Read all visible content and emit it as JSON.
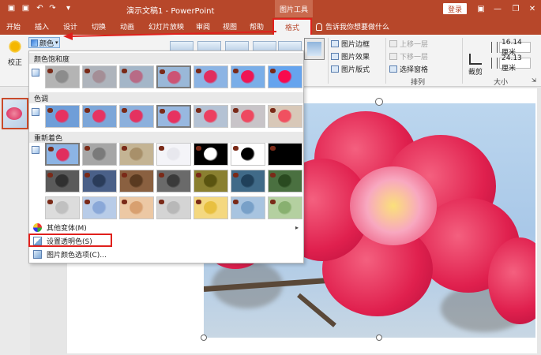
{
  "titlebar": {
    "title": "演示文稿1  -  PowerPoint",
    "picture_tools": "图片工具",
    "login": "登录",
    "minimize": "—",
    "restore": "❐",
    "close": "✕"
  },
  "tabs": {
    "start": "开始",
    "insert": "插入",
    "design": "设计",
    "transitions": "切换",
    "animations": "动画",
    "slideshow": "幻灯片放映",
    "review": "审阅",
    "view": "视图",
    "help": "帮助",
    "format": "格式",
    "tell_me": "告诉我你想要做什么"
  },
  "ribbon": {
    "correct": "校正",
    "color": "颜色",
    "picture_border": "图片边框",
    "picture_effects": "图片效果",
    "picture_layout": "图片版式",
    "bring_forward": "上移一层",
    "send_backward": "下移一层",
    "selection_pane": "选择窗格",
    "arrange": "排列",
    "crop": "裁剪",
    "height": "16.14 厘米",
    "width": "24.13 厘米",
    "size": "大小"
  },
  "dropdown": {
    "saturation_header": "颜色饱和度",
    "tone_header": "色调",
    "recolor_header": "重新着色",
    "more_variations": "其他变体(M)",
    "set_transparent": "设置透明色(S)",
    "color_options": "图片颜色选项(C)...",
    "saturation": [
      {
        "flower": "#8c8c8c",
        "bg": "#b4b4b4"
      },
      {
        "flower": "#a48e96",
        "bg": "#aeb4bc"
      },
      {
        "flower": "#b86b86",
        "bg": "#a4b6c8"
      },
      {
        "flower": "#cc5474",
        "bg": "#9ab8d8"
      },
      {
        "flower": "#e02e5e",
        "bg": "#8cb4e4"
      },
      {
        "flower": "#ee1654",
        "bg": "#7aaee8"
      },
      {
        "flower": "#f80a4e",
        "bg": "#66a4ee"
      }
    ],
    "tone": [
      {
        "flower": "#e63260",
        "bg": "#6f9ed8"
      },
      {
        "flower": "#e63462",
        "bg": "#7ca6d8"
      },
      {
        "flower": "#e43260",
        "bg": "#8cb0dc"
      },
      {
        "flower": "#e63260",
        "bg": "#98b8e0"
      },
      {
        "flower": "#ec4060",
        "bg": "#b4c2d4"
      },
      {
        "flower": "#ee4860",
        "bg": "#c8c4c8"
      },
      {
        "flower": "#f05060",
        "bg": "#d8c8b8"
      }
    ],
    "recolor_row1": [
      {
        "flower": "#e02e5e",
        "bg": "#8cb4e4"
      },
      {
        "flower": "#7a7a7a",
        "bg": "#a6a6a6"
      },
      {
        "flower": "#a8906a",
        "bg": "#c4b494"
      },
      {
        "flower": "#e8e8ee",
        "bg": "#f4f4f8"
      },
      {
        "flower": "#ffffff",
        "bg": "#000000"
      },
      {
        "flower": "#000000",
        "bg": "#ffffff"
      },
      {
        "flower": "#000000",
        "bg": "#000000"
      }
    ],
    "recolor_row2": [
      {
        "flower": "#303030",
        "bg": "#5a5a5a"
      },
      {
        "flower": "#2a3c5a",
        "bg": "#4a6088"
      },
      {
        "flower": "#5a3a20",
        "bg": "#8a6040"
      },
      {
        "flower": "#3a3a3a",
        "bg": "#6a6a6a"
      },
      {
        "flower": "#5a5410",
        "bg": "#8a8030"
      },
      {
        "flower": "#20405a",
        "bg": "#406a88"
      },
      {
        "flower": "#2a4a20",
        "bg": "#4a7040"
      }
    ],
    "recolor_row3": [
      {
        "flower": "#c0c0c0",
        "bg": "#dcdcdc"
      },
      {
        "flower": "#8aa8d8",
        "bg": "#b8cce8"
      },
      {
        "flower": "#d8a070",
        "bg": "#ecc8a4"
      },
      {
        "flower": "#b8b8b8",
        "bg": "#d4d4d4"
      },
      {
        "flower": "#e8c040",
        "bg": "#f4d880"
      },
      {
        "flower": "#78a0c8",
        "bg": "#a8c4e0"
      },
      {
        "flower": "#88b070",
        "bg": "#b4d0a0"
      }
    ]
  }
}
